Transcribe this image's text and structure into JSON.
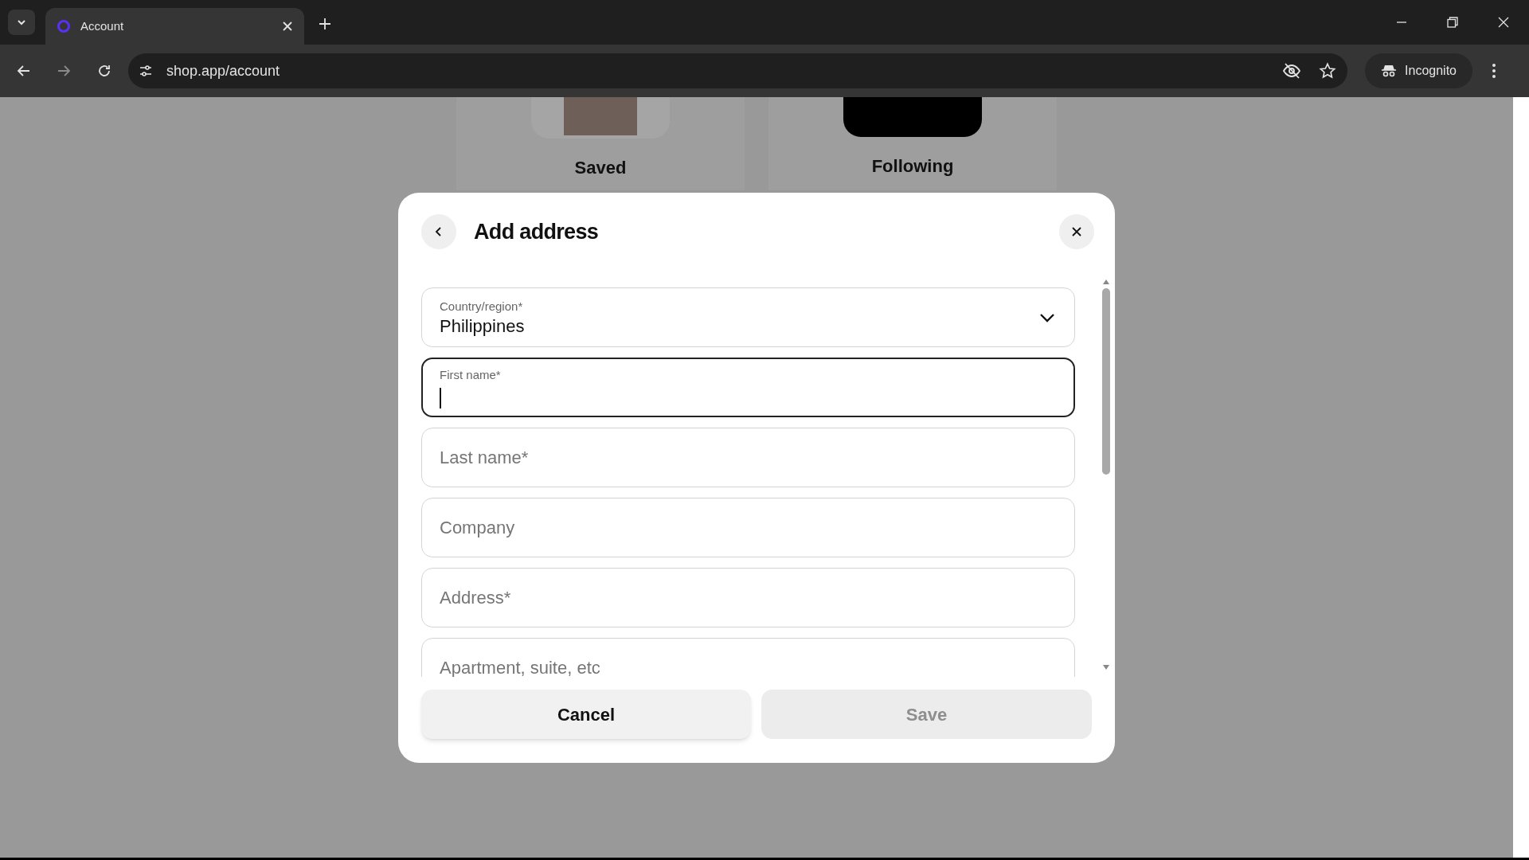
{
  "browser": {
    "tab": {
      "title": "Account"
    },
    "url": "shop.app/account",
    "profile": "Incognito"
  },
  "background_cards": [
    {
      "label": "Saved",
      "kind": "photo"
    },
    {
      "label": "Following",
      "kind": "dark"
    }
  ],
  "dialog": {
    "title": "Add address",
    "fields": [
      {
        "kind": "select",
        "label": "Country/region*",
        "value": "Philippines"
      },
      {
        "kind": "text",
        "label": "First name*",
        "focused": true
      },
      {
        "kind": "text",
        "placeholder": "Last name*",
        "focused": false
      },
      {
        "kind": "text",
        "placeholder": "Company",
        "focused": false
      },
      {
        "kind": "text",
        "placeholder": "Address*",
        "focused": false
      },
      {
        "kind": "text",
        "placeholder": "Apartment, suite, etc",
        "focused": false
      }
    ],
    "buttons": [
      {
        "label": "Cancel",
        "disabled": false
      },
      {
        "label": "Save",
        "disabled": true
      }
    ]
  }
}
